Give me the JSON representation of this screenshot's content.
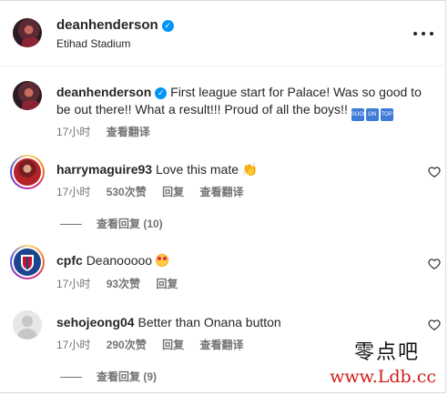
{
  "header": {
    "username": "deanhenderson",
    "location": "Etihad Stadium",
    "verified_icon": "verified-badge-icon",
    "more_icon": "more-options-icon"
  },
  "caption": {
    "username": "deanhenderson",
    "text_line1": "First league start for Palace! Was so good to",
    "text_line2": "be out there!! What a result!!! Proud of all the boys!!",
    "emojis": [
      "SOON",
      "ON",
      "TOP"
    ],
    "time": "17小时",
    "translate": "查看翻译"
  },
  "comments": [
    {
      "username": "harrymaguire93",
      "text": "Love this mate",
      "time": "17小时",
      "likes": "530次赞",
      "reply": "回复",
      "translate": "查看翻译",
      "view_replies": "查看回复 (10)"
    },
    {
      "username": "cpfc",
      "text": "Deanooooo",
      "time": "17小时",
      "likes": "93次赞",
      "reply": "回复"
    },
    {
      "username": "sehojeong04",
      "text": "Better than Onana button",
      "time": "17小时",
      "likes": "290次赞",
      "reply": "回复",
      "translate": "查看翻译",
      "view_replies": "查看回复 (9)"
    }
  ],
  "watermark": {
    "text": "零点吧",
    "url": "www.Ldb.cc"
  },
  "colors": {
    "verified": "#0095f6",
    "secondary_text": "#737373",
    "primary_text": "#262626",
    "watermark_url": "#d21b1b"
  }
}
